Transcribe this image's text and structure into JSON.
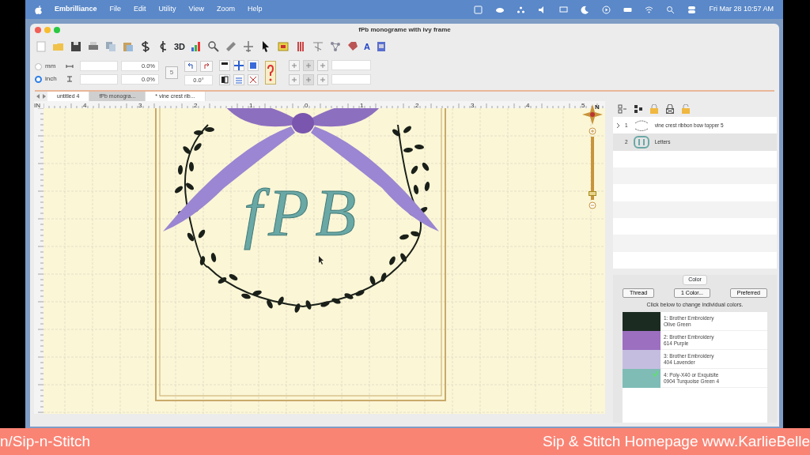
{
  "menu_bar": {
    "app": "Embrilliance",
    "items": [
      "File",
      "Edit",
      "Utility",
      "View",
      "Zoom",
      "Help"
    ],
    "clock": "Fri Mar 28  10:57 AM"
  },
  "window": {
    "title": "fPb monograme with ivy frame"
  },
  "toolbar": {
    "labels": [
      "3D",
      "A"
    ]
  },
  "size_bar": {
    "units": [
      {
        "label": "mm",
        "selected": false
      },
      {
        "label": "inch",
        "selected": true
      }
    ],
    "width_percent": "0.0%",
    "height_percent": "0.0%",
    "step": "5",
    "angle": "0.0°"
  },
  "tabs": [
    {
      "label": "untitled 4",
      "selected": false
    },
    {
      "label": "fPb monogra...",
      "selected": true
    },
    {
      "label": "* vine crest rib...",
      "selected": false
    }
  ],
  "canvas": {
    "ruler_unit": "IN",
    "ruler_labels": [
      "4",
      "3",
      "2",
      "1",
      "0",
      "1",
      "2",
      "3",
      "4",
      "5"
    ],
    "monogram": "fPB",
    "compass": "N",
    "zoom_slider": {
      "level": 0.1
    }
  },
  "objects": [
    {
      "number": "1",
      "name": "vine crest ribbon bow topper 5",
      "expanded": false,
      "selected": false
    },
    {
      "number": "2",
      "name": "Letters",
      "expanded": false,
      "selected": true
    }
  ],
  "color_panel": {
    "title": "Color",
    "buttons": [
      "Thread",
      "1 Color...",
      "Preferred"
    ],
    "hint": "Click below to change individual colors.",
    "threads": [
      {
        "line1": "1: Brother Embroidery",
        "line2": "Olive Green",
        "color": "#1c2b22",
        "selected": false
      },
      {
        "line1": "2: Brother Embroidery",
        "line2": "614 Purple",
        "color": "#9c6fc0",
        "selected": false
      },
      {
        "line1": "3: Brother Embroidery",
        "line2": "404 Lavender",
        "color": "#c5bde0",
        "selected": false
      },
      {
        "line1": "4: Poly-X40 or Exquisite",
        "line2": "0904 Turquoise Green 4",
        "color": "#7fbcb6",
        "selected": true
      }
    ]
  },
  "banner": {
    "left": "n/Sip-n-Stitch",
    "right": "Sip & Stitch Homepage www.KarlieBelle"
  }
}
